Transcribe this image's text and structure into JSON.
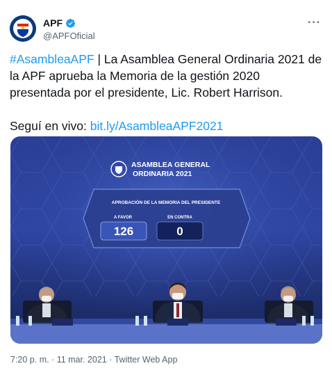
{
  "account": {
    "name": "APF",
    "handle": "@APFOficial",
    "avatar_icon": "apf-crest-icon",
    "verified_icon": "verified-badge-icon",
    "more_icon": "more-options-icon"
  },
  "tweet": {
    "hashtag": "#AsambleaAPF",
    "text_after_hashtag": " | La Asamblea General Ordinaria 2021 de la APF aprueba la Memoria de la gestión 2020 presentada por el presidente, Lic. Robert Harrison.",
    "live_prefix": "Seguí en vivo: ",
    "live_link": "bit.ly/AsambleaAPF2021"
  },
  "media": {
    "screen_title_1": "ASAMBLEA GENERAL",
    "screen_title_2": "ORDINARIA 2021",
    "screen_subtitle": "APROBACIÓN DE LA MEMORIA DEL PRESIDENTE",
    "favor_label": "A FAVOR",
    "favor_value": "126",
    "contra_label": "EN CONTRA",
    "contra_value": "0"
  },
  "footer": {
    "timestamp": "7:20 p. m. · 11 mar. 2021 · Twitter Web App"
  },
  "colors": {
    "link": "#1d9bf0",
    "verified": "#1d9bf0",
    "secondary_text": "#536471"
  }
}
